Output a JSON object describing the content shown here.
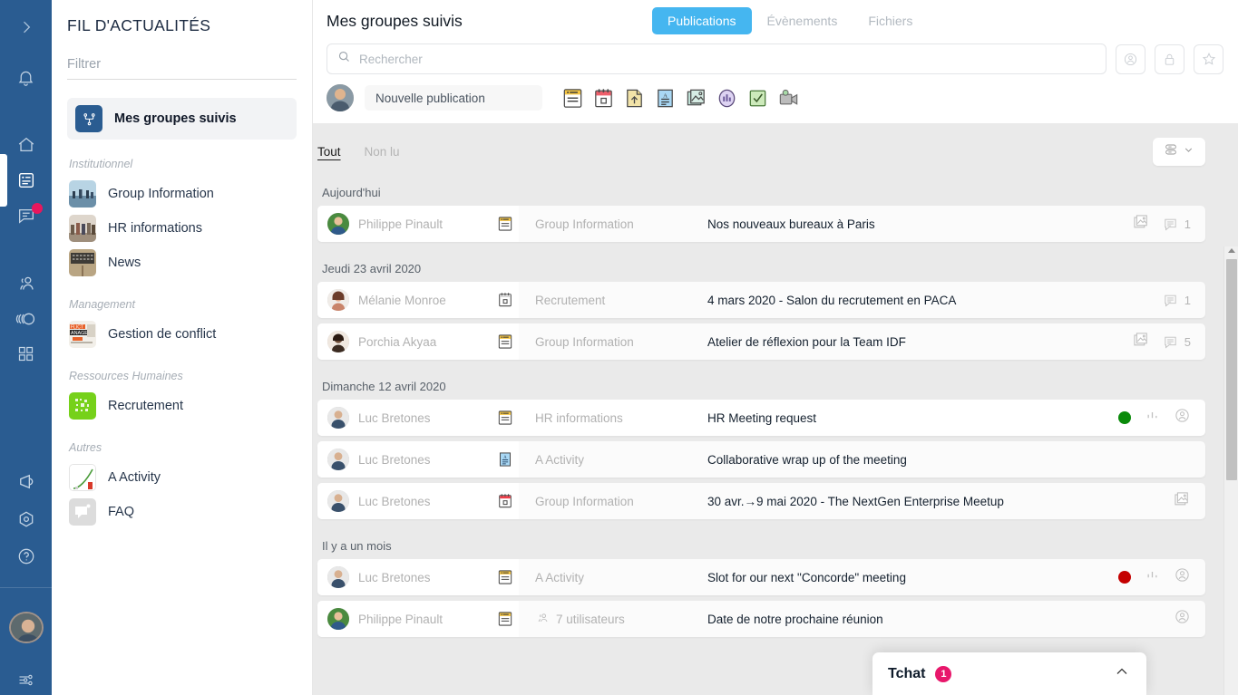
{
  "rail": {
    "icons": [
      {
        "name": "expand-chevron-icon"
      },
      {
        "name": "bell-icon"
      },
      {
        "name": "home-icon"
      },
      {
        "name": "news-feed-icon"
      },
      {
        "name": "chat-bubble-icon",
        "badge": true
      },
      {
        "name": "contacts-icon"
      },
      {
        "name": "waves-icon"
      },
      {
        "name": "apps-grid-icon"
      },
      {
        "name": "megaphone-icon"
      },
      {
        "name": "target-icon"
      },
      {
        "name": "help-icon"
      }
    ],
    "avatar_name": "user-avatar",
    "settings_icon": "sliders-icon"
  },
  "sidebar": {
    "title": "FIL D'ACTUALITÉS",
    "filter_placeholder": "Filtrer",
    "filter_value": "",
    "active_group": "Mes groupes suivis",
    "sections": [
      {
        "label": "Institutionnel",
        "items": [
          {
            "label": "Group Information",
            "thumb": "#5b93b8"
          },
          {
            "label": "HR informations",
            "thumb": "#c9c0b5"
          },
          {
            "label": "News",
            "thumb": "#8a7355"
          }
        ]
      },
      {
        "label": "Management",
        "items": [
          {
            "label": "Gestion de conflict",
            "thumb": "#e0e0d8"
          }
        ]
      },
      {
        "label": "Ressources Humaines",
        "items": [
          {
            "label": "Recrutement",
            "thumb": "#73d216"
          }
        ]
      },
      {
        "label": "Autres",
        "items": [
          {
            "label": "A Activity",
            "thumb": "#ffffff"
          },
          {
            "label": "FAQ",
            "thumb": "#d9d9d9"
          }
        ]
      }
    ]
  },
  "header": {
    "page_title": "Mes groupes suivis",
    "tabs": [
      {
        "label": "Publications",
        "active": true
      },
      {
        "label": "Évènements",
        "active": false
      },
      {
        "label": "Fichiers",
        "active": false
      }
    ],
    "accent_color": "#45b6f0"
  },
  "search": {
    "placeholder": "Rechercher",
    "value": "",
    "actions": [
      {
        "name": "member-filter-button"
      },
      {
        "name": "lock-filter-button"
      },
      {
        "name": "favorite-filter-button"
      }
    ]
  },
  "composer": {
    "placeholder": "Nouvelle publication",
    "tools": [
      {
        "name": "article-icon",
        "color": "#f5c542"
      },
      {
        "name": "event-calendar-icon",
        "color": "#ef7a86"
      },
      {
        "name": "file-upload-icon",
        "color": "#f0e2a8"
      },
      {
        "name": "text-document-icon",
        "color": "#a9d8f5"
      },
      {
        "name": "gallery-image-icon",
        "color": "#bfe0d6"
      },
      {
        "name": "poll-icon",
        "color": "#d6ccf0"
      },
      {
        "name": "task-checklist-icon",
        "color": "#c9e8b8"
      },
      {
        "name": "video-camera-icon",
        "color": "#b8b8b8"
      }
    ]
  },
  "feed": {
    "filters": [
      {
        "label": "Tout",
        "active": true
      },
      {
        "label": "Non lu",
        "active": false
      }
    ],
    "view_button_name": "view-mode-dropdown",
    "groups": [
      {
        "day": "Aujourd'hui",
        "rows": [
          {
            "author": "Philippe Pinault",
            "avatar": "#4a8a3f",
            "type_icon": "article-icon",
            "group": "Group Information",
            "title": "Nos nouveaux bureaux à Paris",
            "has_image": true,
            "comments": "1",
            "status": null,
            "white": false
          }
        ]
      },
      {
        "day": "Jeudi 23 avril 2020",
        "rows": [
          {
            "author": "Mélanie Monroe",
            "avatar": "#c98b72",
            "type_icon": "event-calendar-icon",
            "group": "Recrutement",
            "title": "4 mars 2020 - Salon du recrutement en PACA",
            "has_image": false,
            "comments": "1",
            "status": null,
            "white": false
          },
          {
            "author": "Porchia Akyaa",
            "avatar": "#4a3528",
            "type_icon": "article-icon",
            "group": "Group Information",
            "title": "Atelier de réflexion pour la Team IDF",
            "has_image": true,
            "comments": "5",
            "status": null,
            "white": false
          }
        ]
      },
      {
        "day": "Dimanche 12 avril 2020",
        "rows": [
          {
            "author": "Luc Bretones",
            "avatar": "#5b6b80",
            "type_icon": "article-icon",
            "group": "HR informations",
            "title": "HR Meeting request",
            "has_image": false,
            "comments": null,
            "status": "#0a8a0a",
            "has_stats": true,
            "has_person": true,
            "white": true
          },
          {
            "author": "Luc Bretones",
            "avatar": "#5b6b80",
            "type_icon": "text-document-icon",
            "group": "A Activity",
            "title": "Collaborative wrap up of the meeting",
            "has_image": false,
            "comments": null,
            "status": null,
            "white": false
          },
          {
            "author": "Luc Bretones",
            "avatar": "#5b6b80",
            "type_icon": "event-calendar-icon",
            "group": "Group Information",
            "title": "30 avr.→9 mai 2020 - The NextGen Enterprise Meetup",
            "has_image": true,
            "comments": null,
            "status": null,
            "white": false
          }
        ]
      },
      {
        "day": "Il y a un mois",
        "rows": [
          {
            "author": "Luc Bretones",
            "avatar": "#5b6b80",
            "type_icon": "article-icon",
            "group": "A Activity",
            "title": "Slot for our next \"Concorde\" meeting",
            "has_image": false,
            "comments": null,
            "status": "#c40000",
            "has_stats": true,
            "has_person": true,
            "white": false
          },
          {
            "author": "Philippe Pinault",
            "avatar": "#4a8a3f",
            "type_icon": "article-icon",
            "group": "7 utilisateurs",
            "group_is_users": true,
            "title": "Date de notre prochaine réunion",
            "has_image": false,
            "comments": null,
            "status": null,
            "has_person": true,
            "white": false
          }
        ]
      }
    ]
  },
  "chat": {
    "title": "Tchat",
    "badge": "1",
    "collapse_icon": "chevron-up-icon",
    "badge_color": "#e8176b"
  }
}
